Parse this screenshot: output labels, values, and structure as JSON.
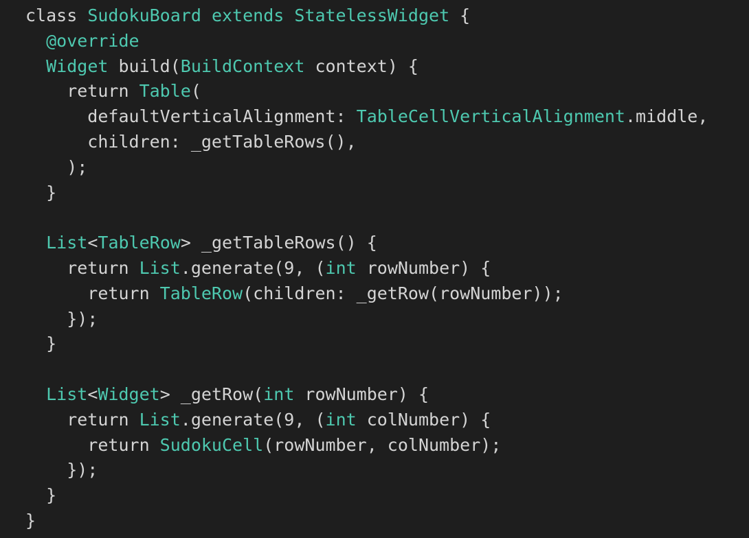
{
  "colors": {
    "background": "#1e1e1e",
    "plain": "#d4d4d4",
    "keyword": "#4ec9b0",
    "type": "#4ec9b0",
    "annotation": "#4ec9b0"
  },
  "code": {
    "lines": [
      [
        {
          "t": "class",
          "k": "plain"
        },
        {
          "t": " SudokuBoard ",
          "k": "type"
        },
        {
          "t": "extends",
          "k": "type"
        },
        {
          "t": " StatelessWidget",
          "k": "type"
        },
        {
          "t": " {",
          "k": "plain"
        }
      ],
      [
        {
          "t": "  ",
          "k": "plain"
        },
        {
          "t": "@override",
          "k": "ann"
        }
      ],
      [
        {
          "t": "  ",
          "k": "plain"
        },
        {
          "t": "Widget",
          "k": "type"
        },
        {
          "t": " build(",
          "k": "plain"
        },
        {
          "t": "BuildContext",
          "k": "type"
        },
        {
          "t": " context) {",
          "k": "plain"
        }
      ],
      [
        {
          "t": "    return ",
          "k": "plain"
        },
        {
          "t": "Table",
          "k": "type"
        },
        {
          "t": "(",
          "k": "plain"
        }
      ],
      [
        {
          "t": "      defaultVerticalAlignment: ",
          "k": "plain"
        },
        {
          "t": "TableCellVerticalAlignment",
          "k": "type"
        },
        {
          "t": ".middle,",
          "k": "plain"
        }
      ],
      [
        {
          "t": "      children: _getTableRows(),",
          "k": "plain"
        }
      ],
      [
        {
          "t": "    );",
          "k": "plain"
        }
      ],
      [
        {
          "t": "  }",
          "k": "plain"
        }
      ],
      [
        {
          "t": "",
          "k": "plain"
        }
      ],
      [
        {
          "t": "  ",
          "k": "plain"
        },
        {
          "t": "List",
          "k": "type"
        },
        {
          "t": "<",
          "k": "plain"
        },
        {
          "t": "TableRow",
          "k": "type"
        },
        {
          "t": "> _getTableRows() {",
          "k": "plain"
        }
      ],
      [
        {
          "t": "    return ",
          "k": "plain"
        },
        {
          "t": "List",
          "k": "type"
        },
        {
          "t": ".generate(9, (",
          "k": "plain"
        },
        {
          "t": "int",
          "k": "type"
        },
        {
          "t": " rowNumber) {",
          "k": "plain"
        }
      ],
      [
        {
          "t": "      return ",
          "k": "plain"
        },
        {
          "t": "TableRow",
          "k": "type"
        },
        {
          "t": "(children: _getRow(rowNumber));",
          "k": "plain"
        }
      ],
      [
        {
          "t": "    });",
          "k": "plain"
        }
      ],
      [
        {
          "t": "  }",
          "k": "plain"
        }
      ],
      [
        {
          "t": "",
          "k": "plain"
        }
      ],
      [
        {
          "t": "  ",
          "k": "plain"
        },
        {
          "t": "List",
          "k": "type"
        },
        {
          "t": "<",
          "k": "plain"
        },
        {
          "t": "Widget",
          "k": "type"
        },
        {
          "t": "> _getRow(",
          "k": "plain"
        },
        {
          "t": "int",
          "k": "type"
        },
        {
          "t": " rowNumber) {",
          "k": "plain"
        }
      ],
      [
        {
          "t": "    return ",
          "k": "plain"
        },
        {
          "t": "List",
          "k": "type"
        },
        {
          "t": ".generate(9, (",
          "k": "plain"
        },
        {
          "t": "int",
          "k": "type"
        },
        {
          "t": " colNumber) {",
          "k": "plain"
        }
      ],
      [
        {
          "t": "      return ",
          "k": "plain"
        },
        {
          "t": "SudokuCell",
          "k": "type"
        },
        {
          "t": "(rowNumber, colNumber);",
          "k": "plain"
        }
      ],
      [
        {
          "t": "    });",
          "k": "plain"
        }
      ],
      [
        {
          "t": "  }",
          "k": "plain"
        }
      ],
      [
        {
          "t": "}",
          "k": "plain"
        }
      ]
    ]
  }
}
